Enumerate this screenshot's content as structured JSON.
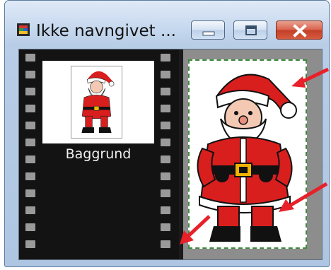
{
  "window": {
    "title": "Ikke navngivet ...",
    "controls": [
      "minimize",
      "maximize",
      "close"
    ],
    "icon": "filmstrip-app-icon"
  },
  "frames_panel": {
    "frames": [
      {
        "label": "Baggrund",
        "thumbnail": "santa-claus-thumbnail"
      }
    ]
  },
  "preview": {
    "image": "santa-claus-image"
  },
  "annotations": {
    "arrow_color": "#e8202a",
    "count": 3
  }
}
